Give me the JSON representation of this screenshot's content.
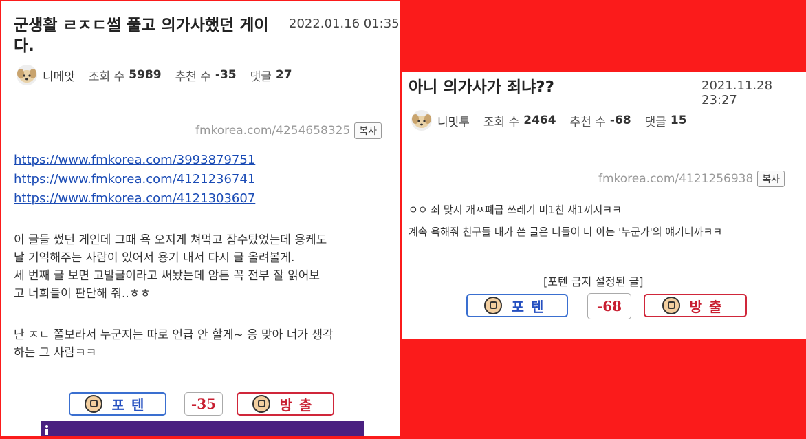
{
  "colors": {
    "background": "#fb1b1b",
    "link": "#1a4bb5",
    "up_button": "#3a6fd0",
    "down_button": "#d0263a",
    "bottom_bar": "#4a2080"
  },
  "left_post": {
    "title": "군생활 ㄹㅈㄷ썰 풀고 의가사했던 게이다.",
    "date": "2022.01.16 01:35",
    "author": "니메앗",
    "views_label": "조회 수",
    "views": "5989",
    "recommend_label": "추천 수",
    "recommend": "-35",
    "comments_label": "댓글",
    "comments": "27",
    "shortlink": "fmkorea.com/4254658325",
    "copy_label": "복사",
    "links": [
      "https://www.fmkorea.com/3993879751",
      "https://www.fmkorea.com/4121236741",
      "https://www.fmkorea.com/4121303607"
    ],
    "body": [
      "이 글들 썼던 게인데 그때 욕 오지게 쳐먹고 잠수탔었는데 용케도",
      "날 기억해주는 사람이 있어서 용기 내서 다시 글 올려볼게.",
      "세 번째 글 보면 고발글이라고 써놨는데 암튼 꼭 전부 잘 읽어보",
      "고 너희들이 판단해 줘..ㅎㅎ",
      "",
      "난 ㅈㄴ 쫄보라서 누군지는 따로 언급 안 할게~ 응 맞아 너가 생각",
      "하는 그 사람ㅋㅋ"
    ],
    "vote_up_label": "포텐",
    "vote_count": "-35",
    "vote_down_label": "방출"
  },
  "right_post": {
    "title": "아니 의가사가 죄냐??",
    "date": "2021.11.28 23:27",
    "author": "니밋투",
    "views_label": "조회 수",
    "views": "2464",
    "recommend_label": "추천 수",
    "recommend": "-68",
    "comments_label": "댓글",
    "comments": "15",
    "shortlink": "fmkorea.com/4121256938",
    "copy_label": "복사",
    "body": [
      "ㅇㅇ 죄 맞지 개ㅆ폐급 쓰레기 미1친 새1끼지ㅋㅋ",
      "계속 욕해줘 친구들 내가 쓴 글은 니들이 다 아는 '누군가'의 얘기니까ㅋㅋ"
    ],
    "notice": "[포텐 금지 설정된 글]",
    "vote_up_label": "포텐",
    "vote_count": "-68",
    "vote_down_label": "방출"
  }
}
